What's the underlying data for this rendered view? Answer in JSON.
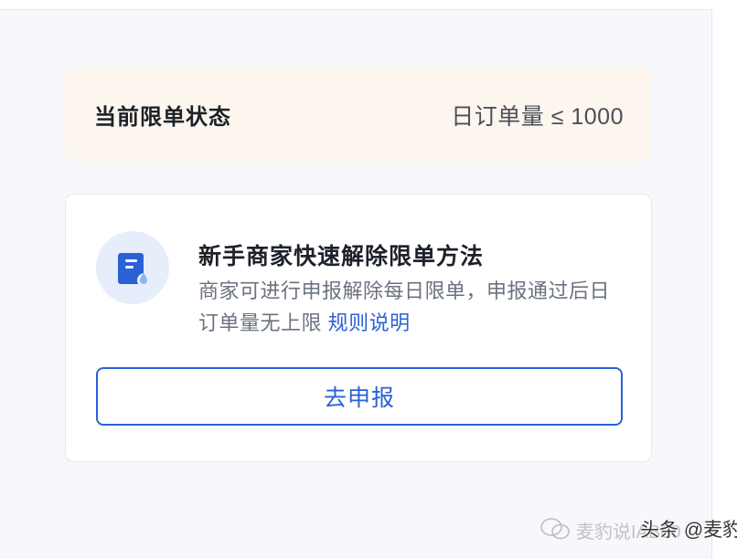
{
  "status": {
    "label": "当前限单状态",
    "value": "日订单量 ≤ 1000"
  },
  "card": {
    "icon": "document-icon",
    "title": "新手商家快速解除限单方法",
    "description": "商家可进行申报解除每日限单，申报通过后日订单量无上限",
    "link_label": "规则说明",
    "button_label": "去申报"
  },
  "watermark": {
    "faint_text": "麦豹说IAB00",
    "text": "头条 @麦豹说"
  },
  "colors": {
    "accent": "#2a62d6",
    "status_bg": "#fdf6ee",
    "icon_bg": "#e6eefc"
  }
}
